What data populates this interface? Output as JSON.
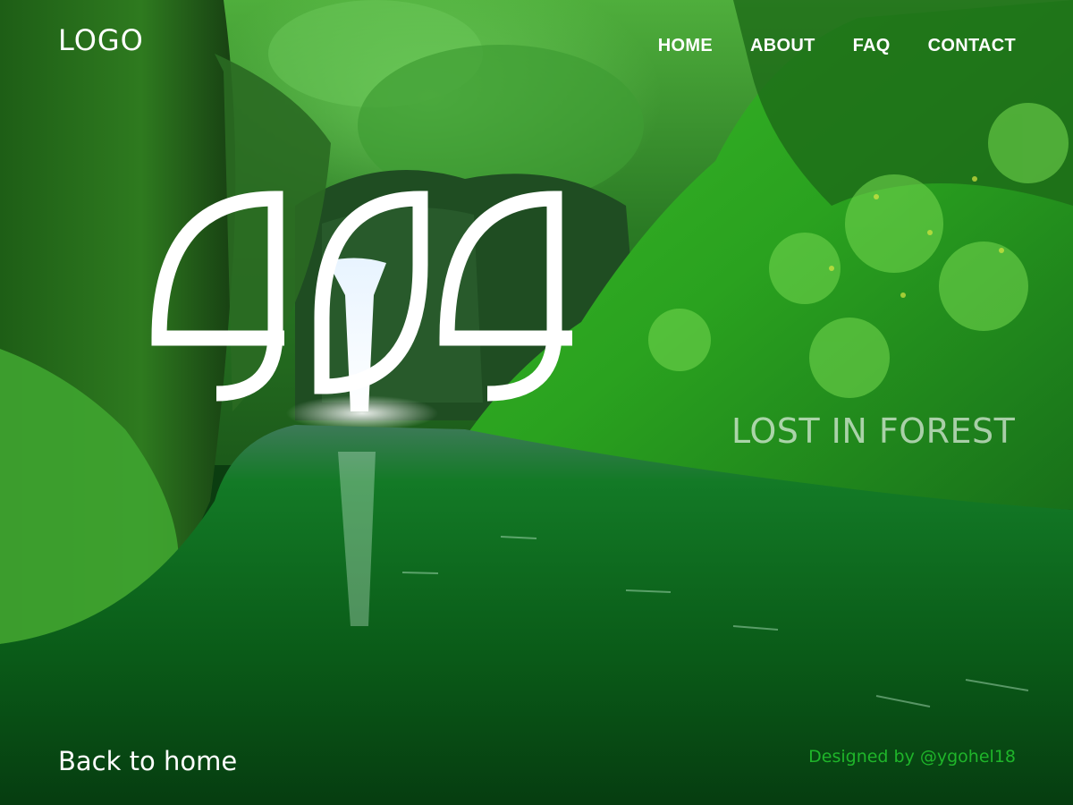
{
  "header": {
    "logo": "LOGO",
    "nav": [
      {
        "label": "HOME"
      },
      {
        "label": "ABOUT"
      },
      {
        "label": "FAQ"
      },
      {
        "label": "CONTACT"
      }
    ]
  },
  "hero": {
    "error_code": "404",
    "tagline": "LOST IN FOREST"
  },
  "footer": {
    "back_link": "Back to home",
    "credit": "Designed by @ygohel18"
  },
  "colors": {
    "text": "#ffffff",
    "credit": "#1fb52a",
    "foliage": "#1f9a1a",
    "water": "#0d5a1b"
  }
}
